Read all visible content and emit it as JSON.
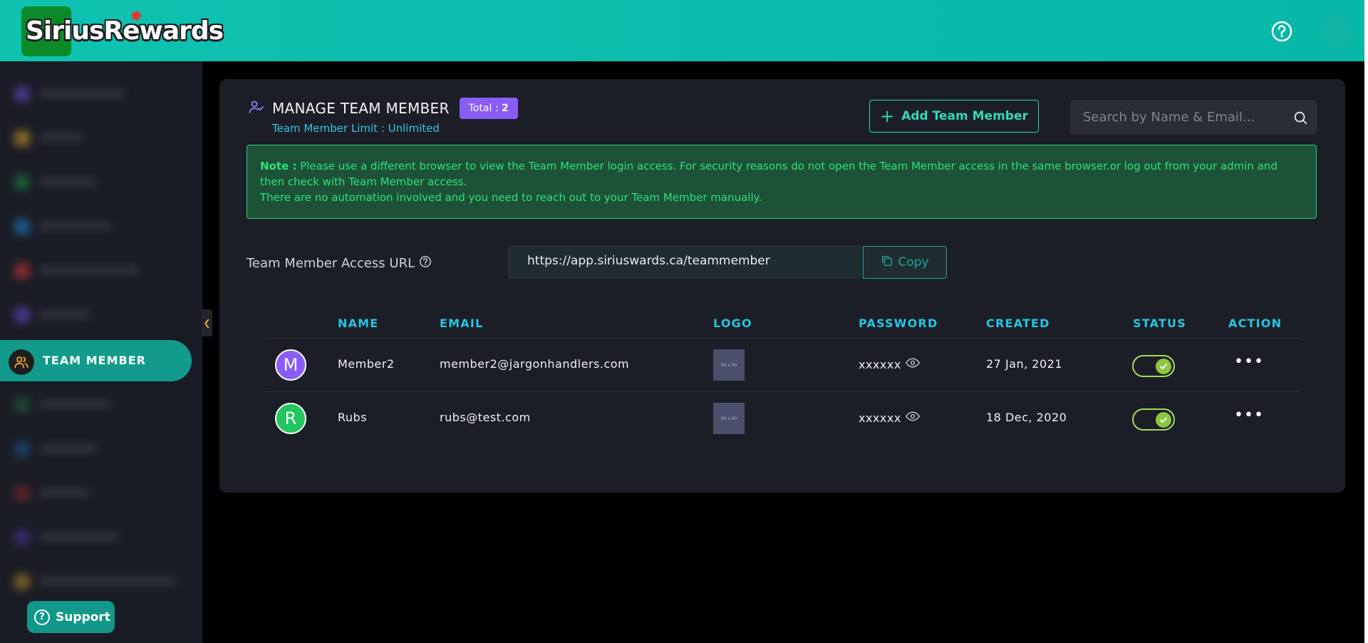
{
  "app": {
    "logo_text_1": "Sirius",
    "logo_text_2": "Rewards"
  },
  "sidebar": {
    "active_label": "TEAM MEMBER",
    "support_label": "Support"
  },
  "card": {
    "title": "MANAGE TEAM MEMBER",
    "total_label": "Total :",
    "total_value": "2",
    "limit_text": "Team Member Limit : Unlimited",
    "add_button": "Add Team Member",
    "search_placeholder": "Search by Name & Email...",
    "note_label": "Note :",
    "note_line1": "Please use a different browser to view the Team Member login access. For security reasons do not open the Team Member access in the same browser.or log out from your admin and then check with Team Member access.",
    "note_line2": "There are no automation involved and you need to reach out to your Team Member manually.",
    "url_label": "Team Member Access URL",
    "url_value": "https://app.siriuswards.ca/teammember",
    "copy_label": "Copy"
  },
  "table": {
    "headers": {
      "name": "NAME",
      "email": "EMAIL",
      "logo": "LOGO",
      "password": "PASSWORD",
      "created": "CREATED",
      "status": "STATUS",
      "action": "ACTION"
    },
    "rows": [
      {
        "initial": "M",
        "avatar_color": "#8a5cf6",
        "name": "Member2",
        "email": "member2@jargonhandlers.com",
        "logo_text": "90 x 90",
        "password": "xxxxxx",
        "created": "27 Jan, 2021",
        "status": "on"
      },
      {
        "initial": "R",
        "avatar_color": "#22c55e",
        "name": "Rubs",
        "email": "rubs@test.com",
        "logo_text": "90 x 90",
        "password": "xxxxxx",
        "created": "18 Dec, 2020",
        "status": "on"
      }
    ]
  },
  "colors": {
    "header": "#0fc2b0",
    "accent": "#129b8b",
    "table_header": "#24c7df",
    "note_text": "#2fe07a"
  }
}
